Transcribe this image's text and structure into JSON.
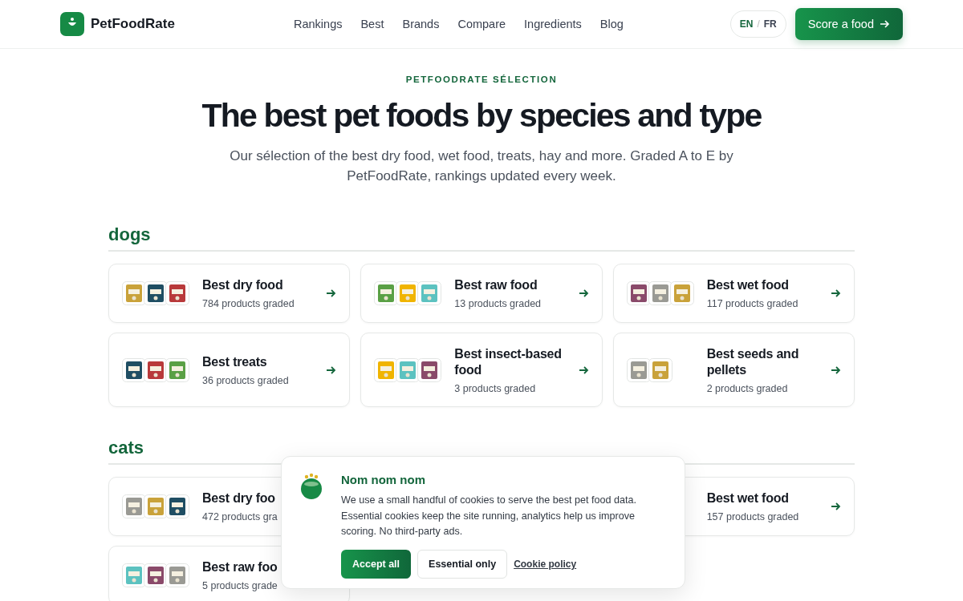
{
  "header": {
    "brand": "PetFoodRate",
    "nav": [
      {
        "label": "Rankings"
      },
      {
        "label": "Best"
      },
      {
        "label": "Brands"
      },
      {
        "label": "Compare"
      },
      {
        "label": "Ingredients"
      },
      {
        "label": "Blog"
      }
    ],
    "languages": [
      {
        "label": "EN",
        "selected": true
      },
      {
        "label": "FR",
        "selected": false
      }
    ],
    "lang_separator": "/",
    "cta": "Score a food"
  },
  "hero": {
    "eyebrow": "PETFOODRATE SÉLECTION",
    "title": "The best pet foods by species and type",
    "subtitle": "Our sélection of the best dry food, wet food, treats, hay and more. Graded A to E by PetFoodRate, rankings updated every week."
  },
  "sections": [
    {
      "title": "dogs",
      "cards": [
        {
          "title": "Best dry food",
          "count": "784 products graded",
          "arrow": true
        },
        {
          "title": "Best raw food",
          "count": "13 products graded",
          "arrow": true
        },
        {
          "title": "Best wet food",
          "count": "117 products graded",
          "arrow": true
        },
        {
          "title": "Best treats",
          "count": "36 products graded",
          "arrow": true
        },
        {
          "title": "Best insect-based food",
          "count": "3 products graded",
          "arrow": true
        },
        {
          "title": "Best seeds and pellets",
          "count": "2 products graded",
          "arrow": true
        }
      ]
    },
    {
      "title": "cats",
      "cards": [
        {
          "title": "Best dry foo",
          "count": "472 products gra",
          "arrow": false
        },
        {
          "title": "Best wet food",
          "count": "157 products graded",
          "arrow": true
        },
        {
          "title": "Best raw foo",
          "count": "5 products grade",
          "arrow": false
        }
      ]
    }
  ],
  "cookie_banner": {
    "title": "Nom nom nom",
    "text": "We use a small handful of cookies to serve the best pet food data. Essential cookies keep the site running, analytics help us improve scoring. No third-party ads.",
    "accept": "Accept all",
    "essential": "Essential only",
    "policy": "Cookie policy"
  }
}
